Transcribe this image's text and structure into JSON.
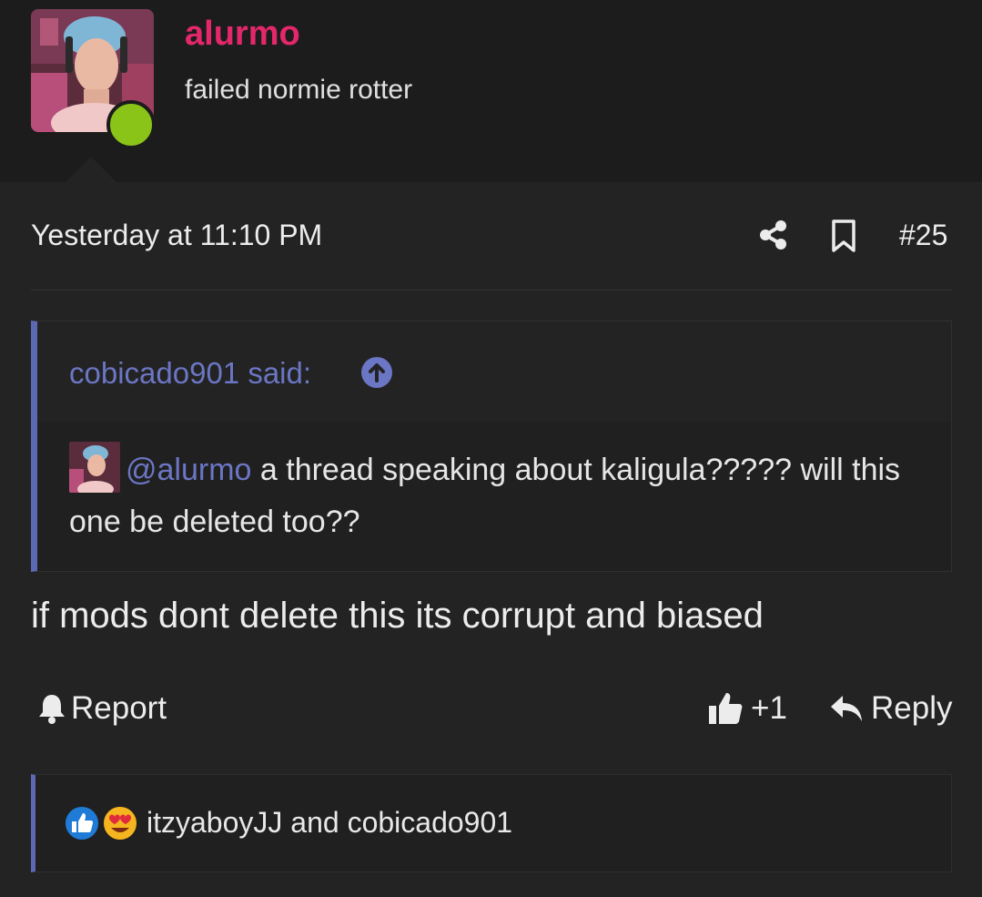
{
  "user": {
    "username": "alurmo",
    "title": "failed normie rotter",
    "avatar_icon": "user-avatar",
    "status": "online"
  },
  "post": {
    "date": "Yesterday at 11:10 PM",
    "number": "#25",
    "share_icon": "share-icon",
    "bookmark_icon": "bookmark-icon",
    "body": "if mods dont delete this its corrupt and biased"
  },
  "quote": {
    "author": "cobicado901 said:",
    "mention": "@alurmo",
    "text_after_mention": " a thread speaking about kaligula????? will this one be deleted too??"
  },
  "actions": {
    "report_label": "Report",
    "like_label": "+1",
    "reply_label": "Reply"
  },
  "reactions": {
    "text": "itzyaboyJJ and cobicado901",
    "icons": [
      "like-reaction-icon",
      "love-reaction-icon"
    ]
  },
  "colors": {
    "username": "#e3276a",
    "accent": "#5c68b3",
    "link": "#6b76c4",
    "online": "#8bc418"
  }
}
